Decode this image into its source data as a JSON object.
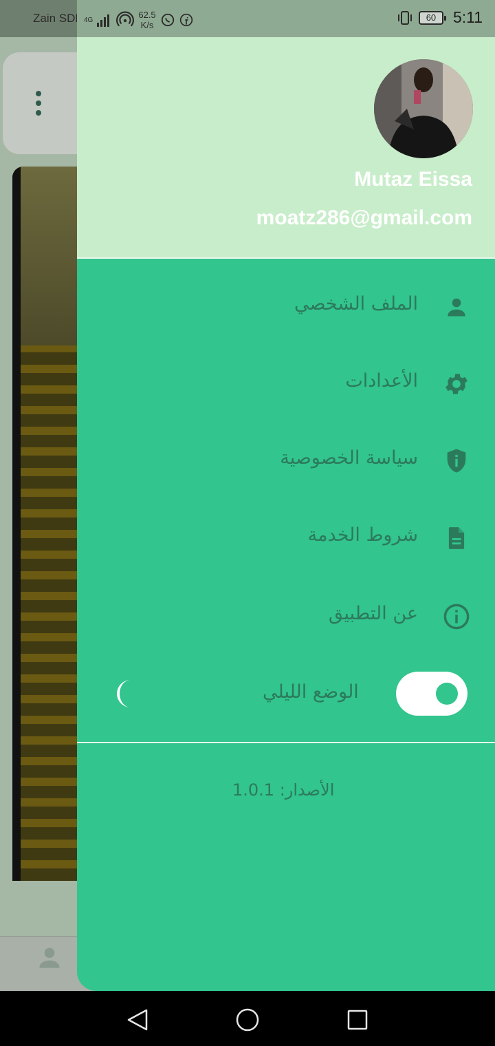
{
  "status_bar": {
    "carrier": "Zain SDN",
    "network": "4G",
    "speed_value": "62.5",
    "speed_unit": "K/s",
    "battery": "60",
    "time": "5:11"
  },
  "profile": {
    "name": "Mutaz Eissa",
    "email": "moatz286@gmail.com"
  },
  "menu": {
    "items": [
      {
        "label": "الملف الشخصي",
        "icon": "person-icon"
      },
      {
        "label": "الأعدادات",
        "icon": "gear-icon"
      },
      {
        "label": "سياسة الخصوصية",
        "icon": "shield-icon"
      },
      {
        "label": "شروط الخدمة",
        "icon": "document-icon"
      },
      {
        "label": "عن التطبيق",
        "icon": "info-icon"
      }
    ],
    "night_mode_label": "الوضع الليلي",
    "night_mode_on": true
  },
  "footer": {
    "version": "الأصدار: 1.0.1"
  },
  "colors": {
    "drawer_bg": "#32c58d",
    "header_bg": "#c8edca",
    "text": "#2c7a5c"
  }
}
